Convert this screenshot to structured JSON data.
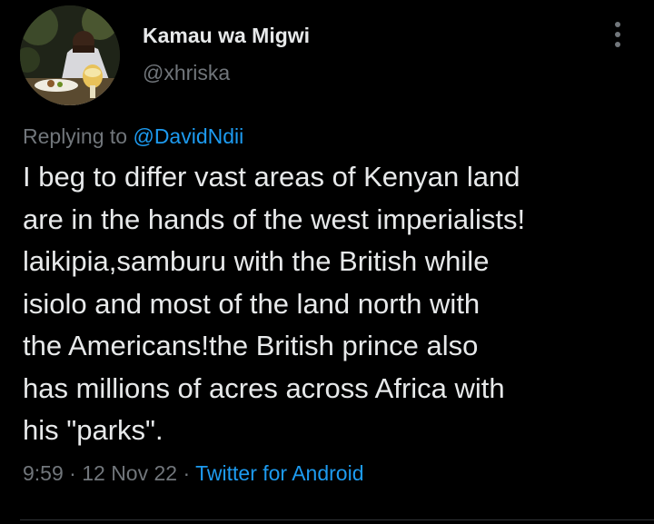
{
  "author": {
    "display_name": "Kamau wa Migwi",
    "handle": "@xhriska"
  },
  "reply": {
    "prefix": "Replying to ",
    "mention": "@DavidNdii"
  },
  "tweet": {
    "lines": [
      "I beg to differ vast areas of Kenyan land",
      "are in the hands of the west imperialists!",
      "laikipia,samburu with the British while",
      "isiolo and most of the land north with",
      "the Americans!the British prince also",
      "has millions of acres across Africa with",
      "his \"parks\"."
    ]
  },
  "meta": {
    "time": "9:59",
    "separator": "·",
    "date": "12 Nov 22",
    "source": "Twitter for Android"
  },
  "icons": {
    "more": "more-vertical-icon"
  },
  "colors": {
    "background": "#000000",
    "text": "#e7e9ea",
    "secondary": "#71767b",
    "link": "#1d9bf0"
  }
}
